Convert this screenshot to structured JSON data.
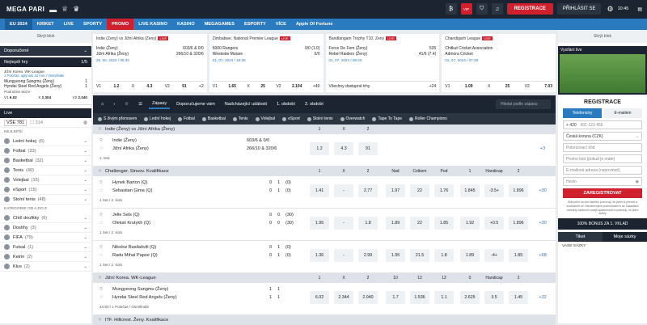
{
  "brand": "MEGA PARI",
  "topbar": {
    "register": "REGISTRACE",
    "login": "PŘIHLÁSIT SE",
    "time": "10:45",
    "vip": "VIP"
  },
  "nav": [
    "EU 2024",
    "KRIKET",
    "LIVE",
    "SPORTY",
    "PROMO",
    "LIVE KASINO",
    "KASINO",
    "MEGAGAMES",
    "ESPORTY",
    "VÍCE",
    "Apple Of Fortune"
  ],
  "left": {
    "hide": "Skrýt blok",
    "favorites": "Doporučené",
    "top": "Nejlepší hry",
    "pager": "1/5",
    "match": {
      "league": "Jižní Korea. WK-League",
      "info": "1 Poločas, uplynulo 44 min. / Osmifinále",
      "t1": "Mungyeong Sangmu (Ženy)",
      "t2": "Hyndai Steel Red Angels (Ženy)",
      "s1": "1",
      "s2": "1",
      "more": "Podrobné skóre",
      "odds": [
        "6.02",
        "2.304",
        "2.040"
      ]
    },
    "live": "Live",
    "all": "VŠE 781",
    "fav": "314",
    "best": "NEJLEPŠÍ",
    "sports": [
      [
        "Lední hokej",
        "(6)"
      ],
      [
        "Fotbal",
        "(33)"
      ],
      [
        "Basketbal",
        "(32)"
      ],
      [
        "Tenis",
        "(40)"
      ],
      [
        "Volejbal",
        "(15)"
      ],
      [
        "eSport",
        "(15)"
      ],
      [
        "Stolní tenis",
        "(48)"
      ]
    ],
    "az": "KATEGORIE OD A DO Z",
    "az_items": [
      [
        "Chtíl doufitky",
        "(6)"
      ],
      [
        "Dostihy",
        "(3)"
      ],
      [
        "FIFA",
        "(79)"
      ],
      [
        "Futsal",
        "(1)"
      ],
      [
        "Keirin",
        "(2)"
      ],
      [
        "Klus",
        "(2)"
      ]
    ]
  },
  "cards": [
    {
      "league": "Indie (Ženy) vs Jižní Afrika (Ženy)",
      "t1": "Indie (Ženy)",
      "s1": "603/6 & 0/0",
      "t2": "Jižní Afrika (Ženy)",
      "s2": "266/10 & 320/6",
      "date": "28. 06. 2024 / 05:30",
      "odds": [
        "V1",
        "1.2",
        "X",
        "4.3",
        "V2",
        "91",
        "+2"
      ]
    },
    {
      "league": "Zimbabwe. National Premier League",
      "t1": "5000 Rangers",
      "s1": "0/0 (1.0)",
      "t2": "Westside Mutare",
      "s2": "0/0",
      "date": "01. 07. 2024 / 18:35",
      "odds": [
        "V1",
        "1.65",
        "X",
        "25",
        "V2",
        "2.104",
        "+40"
      ]
    },
    {
      "league": "Bandlangam Trophy T10. Ženy",
      "t1": "Force De Fem (Ženy)",
      "s1": "535",
      "t2": "Rebel Raiders (Ženy)",
      "s2": "41/6 (7.4)",
      "date": "01. 07. 2024 / 08:20",
      "odds": [
        "Všechny dostupné trhy",
        "+24"
      ]
    },
    {
      "league": "Chandigarh League",
      "t1": "Chitkut Cricket Association",
      "s1": "",
      "t2": "Admora Cricket",
      "s2": "",
      "date": "01. 07. 2024 / 07:30",
      "odds": [
        "V1",
        "1.09",
        "X",
        "25",
        "V2",
        "7.03"
      ]
    }
  ],
  "main": {
    "tabs": [
      "Zápasy",
      "Doporučujeme vám",
      "Nadcházející události",
      "1. období",
      "2. období"
    ],
    "search": "Hledat podle zápasu",
    "sports": [
      "S živým přenosem",
      "Lední hokej",
      "Fotbal",
      "Basketbal",
      "Tenis",
      "Volejbal",
      "eSport",
      "Stolní tenis",
      "Overwatch",
      "Tape To Tape",
      "Roller Champions"
    ],
    "leagues": [
      {
        "name": "Indie (Ženy) vs Jižní Afrika (Ženy)",
        "head": [
          "1",
          "X",
          "2"
        ],
        "rows": [
          {
            "t1": "Indie (Ženy)",
            "t2": "Jižní Afrika (Ženy)",
            "sc": "603/6 & 0/0",
            "sc2": "266/10 & 320/6",
            "info": "1. test",
            "odds": [
              "1.2",
              "4.3",
              "91"
            ],
            "more": "+3"
          }
        ]
      },
      {
        "name": "Challenger. Sinsov. Kvalifikace",
        "head": [
          "1",
          "X",
          "2",
          "Nad",
          "Celkem",
          "Pod",
          "1",
          "Handicap",
          "2"
        ],
        "rows": [
          {
            "t1": "Hynek Barton (Q)",
            "t2": "Sebastian Gima (Q)",
            "s1": [
              "0",
              "1",
              "(0)"
            ],
            "s2": [
              "0",
              "1",
              "(0)"
            ],
            "info": "1 Set / 2. kolo",
            "odds": [
              "1.41",
              "-",
              "2.77",
              "1.97",
              "22",
              "1.76",
              "1.845",
              "-3.5+",
              "1.896"
            ],
            "more": "+30"
          },
          {
            "t1": "Jelle Sels (Q)",
            "t2": "Oleksii Krutykh (Q)",
            "s1": [
              "0",
              "0",
              "(30)"
            ],
            "s2": [
              "0",
              "0",
              "(30)"
            ],
            "info": "1 Set / 2. kolo",
            "odds": [
              "1.95",
              "-",
              "1.8",
              "1.89",
              "22",
              "1.85",
              "1.92",
              "+0.5",
              "1.896"
            ],
            "more": "+30"
          },
          {
            "t1": "Nikoloz Basilašvili (Q)",
            "t2": "Radu Mihai Papoe (Q)",
            "s1": [
              "0",
              "1",
              "(0)"
            ],
            "s2": [
              "0",
              "1",
              "(0)"
            ],
            "info": "1 Set / 2. kolo",
            "odds": [
              "1.36",
              "-",
              "2.99",
              "1.95",
              "21.5",
              "1.8",
              "1.89",
              "-4+",
              "1.85"
            ],
            "more": "+68"
          }
        ]
      },
      {
        "name": "Jižní Korea. WK-League",
        "head": [
          "1",
          "X",
          "2",
          "10",
          "12",
          "12",
          "0",
          "Handicap",
          "2"
        ],
        "rows": [
          {
            "t1": "Mungyeong Sangmu (Ženy)",
            "t2": "Hyndai Steel Red Angels (Ženy)",
            "s1": [
              "1",
              "1"
            ],
            "s2": [
              "1",
              "1"
            ],
            "info": "44:50 / 1 Poločas / Osmifinále",
            "odds": [
              "6.02",
              "2.344",
              "2.040",
              "1.7",
              "1.536",
              "1.1",
              "2.625",
              "3.5",
              "1.45"
            ],
            "more": "+32"
          }
        ]
      },
      {
        "name": "ITF. Hillcrest. Ženy. Kvalifikace",
        "head": [],
        "rows": []
      }
    ]
  },
  "right": {
    "hide": "Skrýt blok",
    "video": "Vysílání live",
    "title": "REGISTRACE",
    "by_phone": "Telefonicky",
    "by_mail": "E-mailem",
    "prefix": "+ 420",
    "phone_ph": "601 123 456",
    "currency": "Česká koruna (CZK)",
    "code": "Potvrzovací kód",
    "promo": "Promo kód (pokud je máte)",
    "email": "E-mailová adresa (nepovinné)",
    "password": "Heslo",
    "submit": "ZAREGISTROVAT",
    "note": "Kliknutím na toto tlačítko potvrzuji, že jsem si přečetl a souhlasím se Všeobecnými podmínkami a se Zásadami ochrany osobních údajů společnosti a potvrzuji, že jsem zletilý",
    "bonus": "100% BONUS ZA 1. VKLAD",
    "tab1": "Tiket",
    "tab2": "Moje sázky",
    "bets": "VAŠE SÁZKY"
  }
}
